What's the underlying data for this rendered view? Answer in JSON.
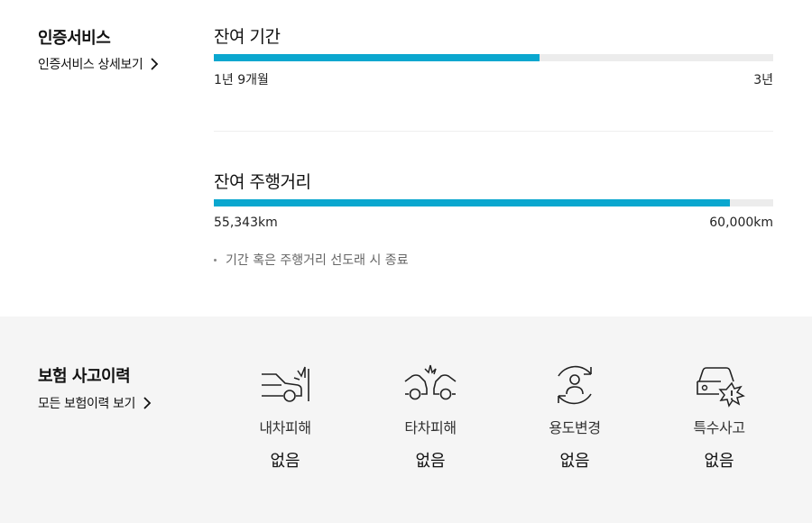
{
  "cert": {
    "title": "인증서비스",
    "link": "인증서비스 상세보기",
    "period": {
      "label": "잔여 기간",
      "min": "1년 9개월",
      "max": "3년",
      "fill_fraction": 0.583
    },
    "mileage": {
      "label": "잔여 주행거리",
      "min": "55,343km",
      "max": "60,000km",
      "fill_fraction": 0.922
    },
    "note": "기간 혹은 주행거리 선도래 시 종료"
  },
  "insurance": {
    "title": "보험 사고이력",
    "link": "모든 보험이력 보기",
    "items": [
      {
        "icon": "own-car-damage-icon",
        "label": "내차피해",
        "value": "없음"
      },
      {
        "icon": "other-car-damage-icon",
        "label": "타차피해",
        "value": "없음"
      },
      {
        "icon": "usage-change-icon",
        "label": "용도변경",
        "value": "없음"
      },
      {
        "icon": "special-accident-icon",
        "label": "특수사고",
        "value": "없음"
      }
    ]
  },
  "colors": {
    "accent": "#0aa7cf",
    "track": "#ececec",
    "panel": "#f5f5f5"
  }
}
